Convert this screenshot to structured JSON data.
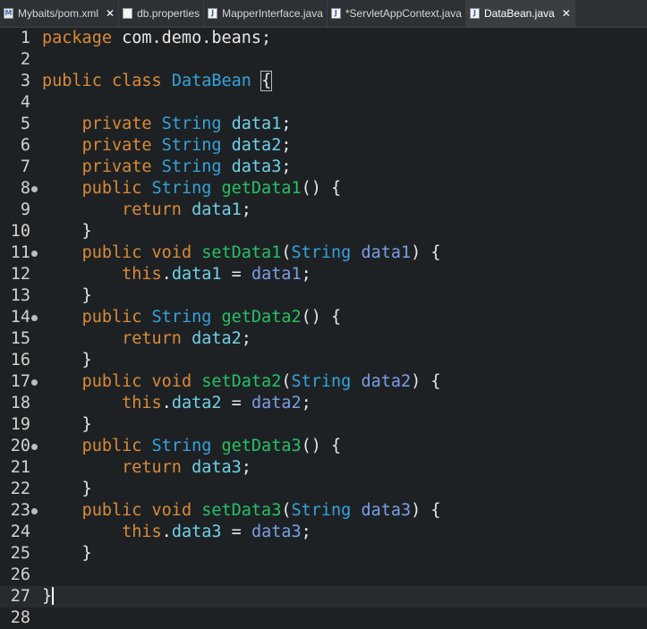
{
  "tabs": [
    {
      "label": "Mybaits/pom.xml",
      "icon": "maven-file-icon",
      "active": false,
      "closable": true
    },
    {
      "label": "db.properties",
      "icon": "properties-file-icon",
      "active": false,
      "closable": false
    },
    {
      "label": "MapperInterface.java",
      "icon": "java-file-icon",
      "active": false,
      "closable": false
    },
    {
      "label": "*ServletAppContext.java",
      "icon": "java-file-icon",
      "active": false,
      "closable": false
    },
    {
      "label": "DataBean.java",
      "icon": "java-file-icon",
      "active": true,
      "closable": true
    }
  ],
  "code": {
    "lines": [
      {
        "n": "1",
        "tokens": [
          [
            "kw",
            "package"
          ],
          [
            "pkg",
            " com.demo.beans;"
          ]
        ]
      },
      {
        "n": "2",
        "tokens": []
      },
      {
        "n": "3",
        "tokens": [
          [
            "kw",
            "public"
          ],
          [
            "pkg",
            " "
          ],
          [
            "kw",
            "class"
          ],
          [
            "pkg",
            " "
          ],
          [
            "ty",
            "DataBean"
          ],
          [
            "pkg",
            " "
          ],
          [
            "brk",
            "{"
          ]
        ]
      },
      {
        "n": "4",
        "tokens": []
      },
      {
        "n": "5",
        "tokens": [
          [
            "pkg",
            "    "
          ],
          [
            "kw",
            "private"
          ],
          [
            "pkg",
            " "
          ],
          [
            "ty",
            "String"
          ],
          [
            "pkg",
            " "
          ],
          [
            "fld",
            "data1"
          ],
          [
            "pkg",
            ";"
          ]
        ]
      },
      {
        "n": "6",
        "tokens": [
          [
            "pkg",
            "    "
          ],
          [
            "kw",
            "private"
          ],
          [
            "pkg",
            " "
          ],
          [
            "ty",
            "String"
          ],
          [
            "pkg",
            " "
          ],
          [
            "fld",
            "data2"
          ],
          [
            "pkg",
            ";"
          ]
        ]
      },
      {
        "n": "7",
        "tokens": [
          [
            "pkg",
            "    "
          ],
          [
            "kw",
            "private"
          ],
          [
            "pkg",
            " "
          ],
          [
            "ty",
            "String"
          ],
          [
            "pkg",
            " "
          ],
          [
            "fld",
            "data3"
          ],
          [
            "pkg",
            ";"
          ]
        ]
      },
      {
        "n": "8",
        "fold": true,
        "tokens": [
          [
            "pkg",
            "    "
          ],
          [
            "kw",
            "public"
          ],
          [
            "pkg",
            " "
          ],
          [
            "ty",
            "String"
          ],
          [
            "pkg",
            " "
          ],
          [
            "mth",
            "getData1"
          ],
          [
            "pkg",
            "() {"
          ]
        ]
      },
      {
        "n": "9",
        "tokens": [
          [
            "pkg",
            "        "
          ],
          [
            "kw",
            "return"
          ],
          [
            "pkg",
            " "
          ],
          [
            "fld",
            "data1"
          ],
          [
            "pkg",
            ";"
          ]
        ]
      },
      {
        "n": "10",
        "tokens": [
          [
            "pkg",
            "    }"
          ]
        ]
      },
      {
        "n": "11",
        "fold": true,
        "tokens": [
          [
            "pkg",
            "    "
          ],
          [
            "kw",
            "public"
          ],
          [
            "pkg",
            " "
          ],
          [
            "kw",
            "void"
          ],
          [
            "pkg",
            " "
          ],
          [
            "mth",
            "setData1"
          ],
          [
            "pkg",
            "("
          ],
          [
            "ty",
            "String"
          ],
          [
            "pkg",
            " "
          ],
          [
            "param",
            "data1"
          ],
          [
            "pkg",
            ") {"
          ]
        ]
      },
      {
        "n": "12",
        "tokens": [
          [
            "pkg",
            "        "
          ],
          [
            "kw",
            "this"
          ],
          [
            "pkg",
            "."
          ],
          [
            "fld",
            "data1"
          ],
          [
            "pkg",
            " = "
          ],
          [
            "param",
            "data1"
          ],
          [
            "pkg",
            ";"
          ]
        ]
      },
      {
        "n": "13",
        "tokens": [
          [
            "pkg",
            "    }"
          ]
        ]
      },
      {
        "n": "14",
        "fold": true,
        "tokens": [
          [
            "pkg",
            "    "
          ],
          [
            "kw",
            "public"
          ],
          [
            "pkg",
            " "
          ],
          [
            "ty",
            "String"
          ],
          [
            "pkg",
            " "
          ],
          [
            "mth",
            "getData2"
          ],
          [
            "pkg",
            "() {"
          ]
        ]
      },
      {
        "n": "15",
        "tokens": [
          [
            "pkg",
            "        "
          ],
          [
            "kw",
            "return"
          ],
          [
            "pkg",
            " "
          ],
          [
            "fld",
            "data2"
          ],
          [
            "pkg",
            ";"
          ]
        ]
      },
      {
        "n": "16",
        "tokens": [
          [
            "pkg",
            "    }"
          ]
        ]
      },
      {
        "n": "17",
        "fold": true,
        "tokens": [
          [
            "pkg",
            "    "
          ],
          [
            "kw",
            "public"
          ],
          [
            "pkg",
            " "
          ],
          [
            "kw",
            "void"
          ],
          [
            "pkg",
            " "
          ],
          [
            "mth",
            "setData2"
          ],
          [
            "pkg",
            "("
          ],
          [
            "ty",
            "String"
          ],
          [
            "pkg",
            " "
          ],
          [
            "param",
            "data2"
          ],
          [
            "pkg",
            ") {"
          ]
        ]
      },
      {
        "n": "18",
        "tokens": [
          [
            "pkg",
            "        "
          ],
          [
            "kw",
            "this"
          ],
          [
            "pkg",
            "."
          ],
          [
            "fld",
            "data2"
          ],
          [
            "pkg",
            " = "
          ],
          [
            "param",
            "data2"
          ],
          [
            "pkg",
            ";"
          ]
        ]
      },
      {
        "n": "19",
        "tokens": [
          [
            "pkg",
            "    }"
          ]
        ]
      },
      {
        "n": "20",
        "fold": true,
        "tokens": [
          [
            "pkg",
            "    "
          ],
          [
            "kw",
            "public"
          ],
          [
            "pkg",
            " "
          ],
          [
            "ty",
            "String"
          ],
          [
            "pkg",
            " "
          ],
          [
            "mth",
            "getData3"
          ],
          [
            "pkg",
            "() {"
          ]
        ]
      },
      {
        "n": "21",
        "tokens": [
          [
            "pkg",
            "        "
          ],
          [
            "kw",
            "return"
          ],
          [
            "pkg",
            " "
          ],
          [
            "fld",
            "data3"
          ],
          [
            "pkg",
            ";"
          ]
        ]
      },
      {
        "n": "22",
        "tokens": [
          [
            "pkg",
            "    }"
          ]
        ]
      },
      {
        "n": "23",
        "fold": true,
        "tokens": [
          [
            "pkg",
            "    "
          ],
          [
            "kw",
            "public"
          ],
          [
            "pkg",
            " "
          ],
          [
            "kw",
            "void"
          ],
          [
            "pkg",
            " "
          ],
          [
            "mth",
            "setData3"
          ],
          [
            "pkg",
            "("
          ],
          [
            "ty",
            "String"
          ],
          [
            "pkg",
            " "
          ],
          [
            "param",
            "data3"
          ],
          [
            "pkg",
            ") {"
          ]
        ]
      },
      {
        "n": "24",
        "tokens": [
          [
            "pkg",
            "        "
          ],
          [
            "kw",
            "this"
          ],
          [
            "pkg",
            "."
          ],
          [
            "fld",
            "data3"
          ],
          [
            "pkg",
            " = "
          ],
          [
            "param",
            "data3"
          ],
          [
            "pkg",
            ";"
          ]
        ]
      },
      {
        "n": "25",
        "tokens": [
          [
            "pkg",
            "    }"
          ]
        ]
      },
      {
        "n": "26",
        "tokens": []
      },
      {
        "n": "27",
        "current": true,
        "cursor": true,
        "tokens": [
          [
            "pkg",
            "}"
          ]
        ]
      },
      {
        "n": "28",
        "tokens": []
      }
    ]
  },
  "colors": {
    "background": "#1e2124",
    "keyword": "#d98b37",
    "type": "#35a3d9",
    "field": "#6fd2e8",
    "method": "#26c166",
    "parameter": "#7a9fe6"
  }
}
